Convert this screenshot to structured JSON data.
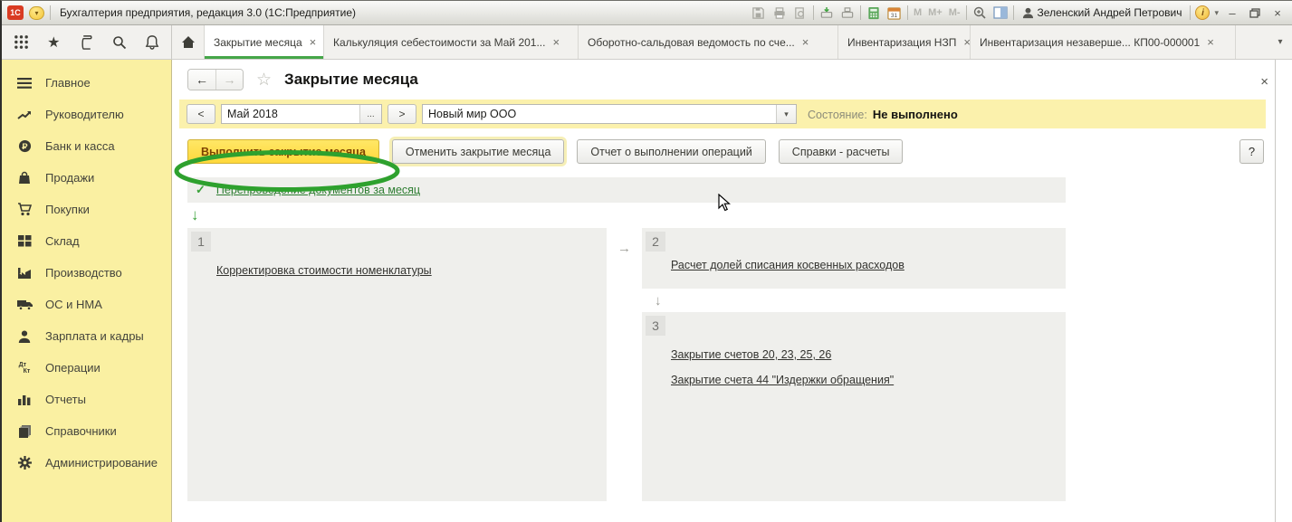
{
  "titlebar": {
    "app_title": "Бухгалтерия предприятия, редакция 3.0 (1С:Предприятие)",
    "logo_text": "1С",
    "user_name": "Зеленский Андрей Петрович",
    "memory": [
      "M",
      "M+",
      "M-"
    ],
    "info_glyph": "i",
    "calendar_day": "31"
  },
  "tabbar": {
    "tabs": [
      {
        "label": "Закрытие месяца",
        "active": true
      },
      {
        "label": "Калькуляция себестоимости за Май 201...",
        "active": false
      },
      {
        "label": "Оборотно-сальдовая ведомость по сче...",
        "active": false
      },
      {
        "label": "Инвентаризация НЗП",
        "active": false
      },
      {
        "label": "Инвентаризация незаверше... КП00-000001",
        "active": false
      }
    ]
  },
  "sidebar": {
    "items": [
      {
        "label": "Главное"
      },
      {
        "label": "Руководителю"
      },
      {
        "label": "Банк и касса"
      },
      {
        "label": "Продажи"
      },
      {
        "label": "Покупки"
      },
      {
        "label": "Склад"
      },
      {
        "label": "Производство"
      },
      {
        "label": "ОС и НМА"
      },
      {
        "label": "Зарплата и кадры"
      },
      {
        "label": "Операции"
      },
      {
        "label": "Отчеты"
      },
      {
        "label": "Справочники"
      },
      {
        "label": "Администрирование"
      }
    ],
    "operations_icon_text_debit": "Дт",
    "operations_icon_text_credit": "Кт"
  },
  "main": {
    "page_title": "Закрытие месяца",
    "period": {
      "value": "Май 2018",
      "browse_label": "..."
    },
    "organization": {
      "value": "Новый мир ООО"
    },
    "status": {
      "label": "Состояние:",
      "value": "Не выполнено"
    },
    "actions": {
      "perform_label": "Выполнить закрытие месяца",
      "cancel_label": "Отменить закрытие месяца",
      "report_label": "Отчет о выполнении операций",
      "references_label": "Справки - расчеты",
      "help_label": "?"
    },
    "reposting_link": "Перепроведение документов за месяц",
    "steps": [
      {
        "number": "1",
        "links": [
          "Корректировка стоимости номенклатуры"
        ]
      },
      {
        "number": "2",
        "links": [
          "Расчет долей списания косвенных расходов"
        ]
      },
      {
        "number": "3",
        "links": [
          "Закрытие счетов 20, 23, 25, 26",
          "Закрытие счета 44 \"Издержки обращения\""
        ]
      }
    ]
  },
  "icons": {
    "back": "←",
    "forward": "→",
    "favorite": "☆",
    "close": "×",
    "prev": "<",
    "next": ">",
    "dropdown": "▾",
    "check": "✓",
    "arrow_down": "↓",
    "arrow_right": "→",
    "star_toolbar": "★",
    "minimize": "–"
  },
  "colors": {
    "accent_green": "#45a648",
    "annotation_green": "#2ea12e",
    "sidebar_yellow": "#faf0a2",
    "bar_yellow": "#fbf1ac",
    "button_yellow": "#ffd83c",
    "panel_gray": "#efefec",
    "link_green": "#2e7d32"
  }
}
